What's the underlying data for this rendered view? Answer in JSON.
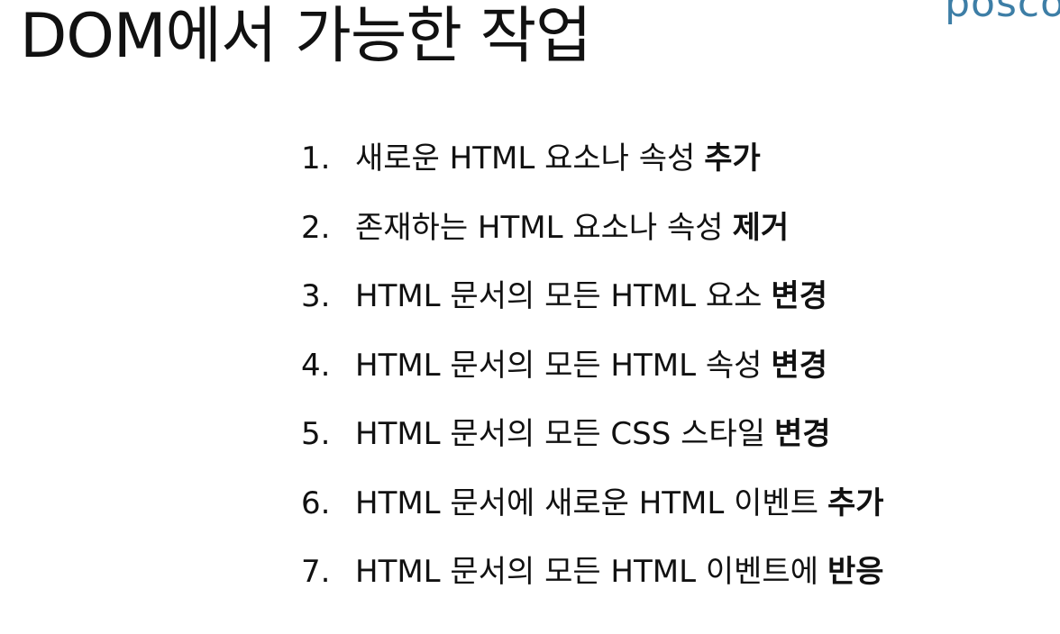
{
  "slide": {
    "title": "DOM에서 가능한 작업",
    "logo_text": "posco"
  },
  "items": [
    {
      "number": "1.",
      "text": "새로운 HTML 요소나 속성",
      "emphasis": "추가"
    },
    {
      "number": "2.",
      "text": "존재하는 HTML 요소나 속성",
      "emphasis": "제거"
    },
    {
      "number": "3.",
      "text": "HTML 문서의 모든 HTML 요소",
      "emphasis": "변경"
    },
    {
      "number": "4.",
      "text": "HTML 문서의 모든 HTML 속성",
      "emphasis": "변경"
    },
    {
      "number": "5.",
      "text": "HTML 문서의 모든 CSS 스타일",
      "emphasis": "변경"
    },
    {
      "number": "6.",
      "text": "HTML 문서에 새로운 HTML 이벤트",
      "emphasis": "추가"
    },
    {
      "number": "7.",
      "text": "HTML 문서의 모든 HTML 이벤트에",
      "emphasis": "반응"
    }
  ],
  "colors": {
    "text": "#111111",
    "logo": "#3d7ea6",
    "background": "#ffffff"
  }
}
